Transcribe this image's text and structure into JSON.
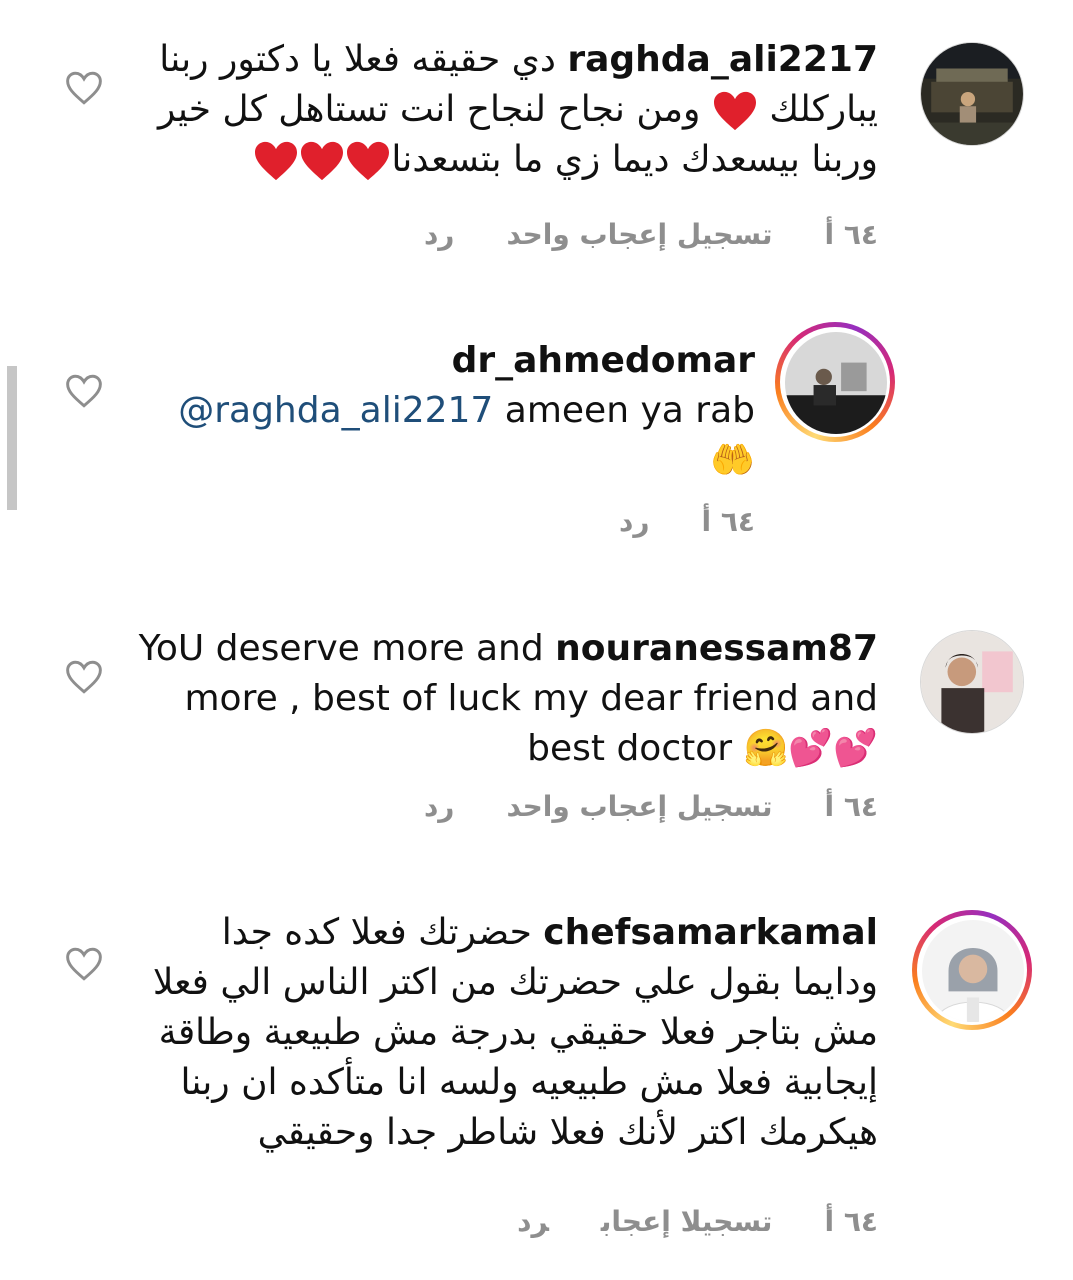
{
  "comments": [
    {
      "username": "raghda_ali2217",
      "lines": [
        "دي حقيقه فعلا يا دكتور ربنا",
        "يباركلك ❤ ومن نجاح لنجاح انت تستاهل كل خير",
        "وربنا بيسعدك ديما زي ما بتسعدنا❤❤❤"
      ],
      "line1_prefix": "دي حقيقه فعلا يا دكتور ربنا",
      "line2_start": "يباركلك",
      "line2_end": "ومن نجاح لنجاح انت تستاهل كل خير",
      "line3": "وربنا بيسعدك ديما زي ما بتسعدنا",
      "time": "٦٤ أ",
      "likes": "تسجيل إعجاب واحد",
      "reply": "رد"
    },
    {
      "username": "dr_ahmedomar",
      "mention": "@raghda_ali2217",
      "text": "ameen ya rab",
      "emoji": "🤲",
      "time": "٦٤ أ",
      "reply": "رد"
    },
    {
      "username": "nouranessam87",
      "text_line1": "YoU deserve more and",
      "text_line2": "more , best of luck my dear friend and",
      "text_line3": "best doctor",
      "emojis": "🤗💕💕",
      "time": "٦٤ أ",
      "likes": "تسجيل إعجاب واحد",
      "reply": "رد"
    },
    {
      "username": "chefsamarkamal",
      "line1": "حضرتك فعلا كده جدا",
      "line2": "ودايما بقول علي حضرتك من اكتر الناس الي فعلا",
      "line3": "مش بتاجر فعلا حقيقي بدرجة مش طبيعية وطاقة",
      "line4": "إيجابية فعلا مش طبيعيه ولسه انا متأكده ان ربنا",
      "line5": "هيكرمك اكتر لأنك فعلا شاطر جدا وحقيقي",
      "time": "٦٤ أ",
      "likes": "تسجيلا إعجاب",
      "reply": "رد"
    }
  ],
  "icons": {
    "like": "heart-outline-icon",
    "emoji_heart": "red-heart-emoji"
  },
  "colors": {
    "meta_gray": "#8e8e8e",
    "mention_blue": "#1f4e79",
    "emoji_red": "#e0202c"
  }
}
